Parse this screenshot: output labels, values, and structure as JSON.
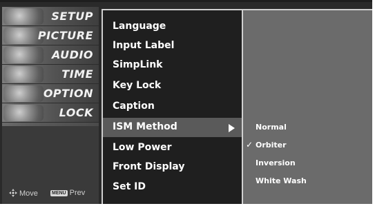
{
  "categories": [
    {
      "label": "SETUP",
      "icon": "setup-thumbnail-icon"
    },
    {
      "label": "PICTURE",
      "icon": "picture-thumbnail-icon"
    },
    {
      "label": "AUDIO",
      "icon": "audio-thumbnail-icon"
    },
    {
      "label": "TIME",
      "icon": "time-thumbnail-icon"
    },
    {
      "label": "OPTION",
      "icon": "option-thumbnail-icon"
    },
    {
      "label": "LOCK",
      "icon": "lock-thumbnail-icon"
    }
  ],
  "hints": {
    "move_label": "Move",
    "menu_key": "MENU",
    "prev_label": "Prev"
  },
  "menu": {
    "items": [
      {
        "label": "Language"
      },
      {
        "label": "Input Label"
      },
      {
        "label": "SimpLink"
      },
      {
        "label": "Key Lock"
      },
      {
        "label": "Caption"
      },
      {
        "label": "ISM Method",
        "selected": true
      },
      {
        "label": "Low Power"
      },
      {
        "label": "Front Display"
      },
      {
        "label": "Set ID"
      }
    ],
    "arrow_glyph": "▶"
  },
  "submenu": {
    "check_glyph": "✓",
    "items": [
      {
        "label": "Normal",
        "checked": false
      },
      {
        "label": "Orbiter",
        "checked": true
      },
      {
        "label": "Inversion",
        "checked": false
      },
      {
        "label": "White Wash",
        "checked": false
      }
    ]
  },
  "colors": {
    "frame": "#2a2a2a",
    "menu_bg": "#1f1f1f",
    "submenu_bg": "#6b6b6b",
    "highlight": "#5a5a5a",
    "text": "#ffffff"
  }
}
